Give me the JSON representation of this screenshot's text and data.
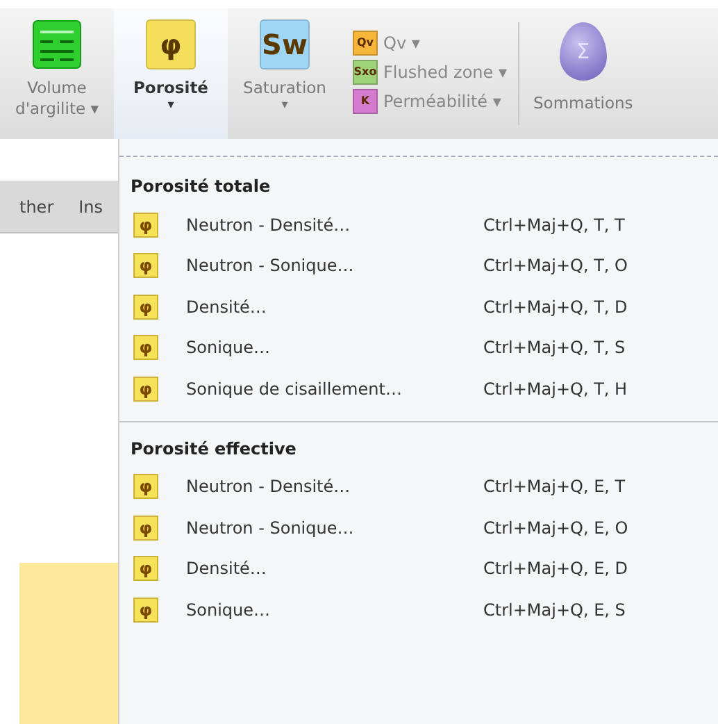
{
  "ribbon": {
    "large_buttons": [
      {
        "kind": "grid",
        "lines": [
          "Volume",
          "d'argilite"
        ],
        "caret": "▾",
        "caret_inline": true,
        "selected": false
      },
      {
        "kind": "glyph",
        "icon_text": "φ",
        "color": "#f5df5a",
        "lines": [
          "Porosité"
        ],
        "caret": "▾",
        "caret_inline": false,
        "selected": true
      },
      {
        "kind": "glyph",
        "icon_text": "Sw",
        "color": "#9fd6f5",
        "lines": [
          "Saturation"
        ],
        "caret": "▾",
        "caret_inline": false,
        "selected": false
      }
    ],
    "small_buttons": [
      {
        "icon_text": "Qv",
        "color": "#f5b63a",
        "label": "Qv",
        "caret": "▾"
      },
      {
        "icon_text": "Sxo",
        "color": "#9ed37a",
        "label": "Flushed zone",
        "caret": "▾"
      },
      {
        "icon_text": "K",
        "color": "#d57bd0",
        "label": "Perméabilité",
        "caret": "▾"
      }
    ],
    "end_button": {
      "icon_text": "Σ",
      "label": "Sommations"
    }
  },
  "left_pane": {
    "tabs": [
      {
        "label": "ther"
      },
      {
        "label": "Ins"
      }
    ]
  },
  "menu": {
    "sections": [
      {
        "title": "Porosité totale",
        "items": [
          {
            "icon_text": "φ",
            "label": "Neutron - Densité…",
            "shortcut": "Ctrl+Maj+Q, T, T"
          },
          {
            "icon_text": "φ",
            "label": "Neutron - Sonique…",
            "shortcut": "Ctrl+Maj+Q, T, O"
          },
          {
            "icon_text": "φ",
            "label": "Densité…",
            "shortcut": "Ctrl+Maj+Q, T, D"
          },
          {
            "icon_text": "φ",
            "label": "Sonique…",
            "shortcut": "Ctrl+Maj+Q, T, S"
          },
          {
            "icon_text": "φ",
            "label": "Sonique de cisaillement…",
            "shortcut": "Ctrl+Maj+Q, T, H"
          }
        ]
      },
      {
        "title": "Porosité effective",
        "items": [
          {
            "icon_text": "φ",
            "label": "Neutron - Densité…",
            "shortcut": "Ctrl+Maj+Q, E, T"
          },
          {
            "icon_text": "φ",
            "label": "Neutron - Sonique…",
            "shortcut": "Ctrl+Maj+Q, E, O"
          },
          {
            "icon_text": "φ",
            "label": "Densité…",
            "shortcut": "Ctrl+Maj+Q, E, D"
          },
          {
            "icon_text": "φ",
            "label": "Sonique…",
            "shortcut": "Ctrl+Maj+Q, E, S"
          }
        ]
      }
    ]
  }
}
